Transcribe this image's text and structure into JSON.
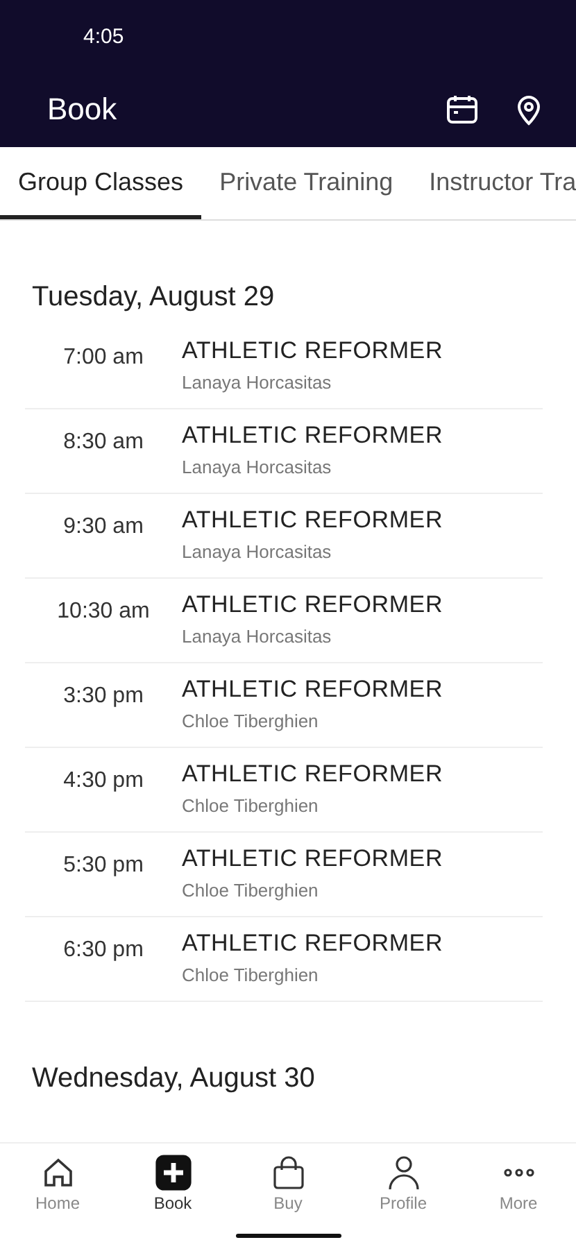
{
  "status_bar": {
    "time": "4:05"
  },
  "app_bar": {
    "title": "Book"
  },
  "tabs": [
    {
      "label": "Group Classes",
      "selected": true
    },
    {
      "label": "Private Training",
      "selected": false
    },
    {
      "label": "Instructor Tra",
      "selected": false
    }
  ],
  "days": [
    {
      "date": "Tuesday, August 29",
      "classes": [
        {
          "time": "7:00 am",
          "name": "ATHLETIC REFORMER",
          "instructor": "Lanaya Horcasitas"
        },
        {
          "time": "8:30 am",
          "name": "ATHLETIC REFORMER",
          "instructor": "Lanaya Horcasitas"
        },
        {
          "time": "9:30 am",
          "name": "ATHLETIC REFORMER",
          "instructor": "Lanaya Horcasitas"
        },
        {
          "time": "10:30 am",
          "name": "ATHLETIC REFORMER",
          "instructor": "Lanaya Horcasitas"
        },
        {
          "time": "3:30 pm",
          "name": "ATHLETIC REFORMER",
          "instructor": "Chloe Tiberghien"
        },
        {
          "time": "4:30 pm",
          "name": "ATHLETIC REFORMER",
          "instructor": "Chloe Tiberghien"
        },
        {
          "time": "5:30 pm",
          "name": "ATHLETIC REFORMER",
          "instructor": "Chloe Tiberghien"
        },
        {
          "time": "6:30 pm",
          "name": "ATHLETIC REFORMER",
          "instructor": "Chloe Tiberghien"
        }
      ]
    },
    {
      "date": "Wednesday, August 30"
    }
  ],
  "bottom_nav": [
    {
      "label": "Home",
      "kind": "home",
      "selected": false
    },
    {
      "label": "Book",
      "kind": "book",
      "selected": true
    },
    {
      "label": "Buy",
      "kind": "buy",
      "selected": false
    },
    {
      "label": "Profile",
      "kind": "profile",
      "selected": false
    },
    {
      "label": "More",
      "kind": "more",
      "selected": false
    }
  ]
}
